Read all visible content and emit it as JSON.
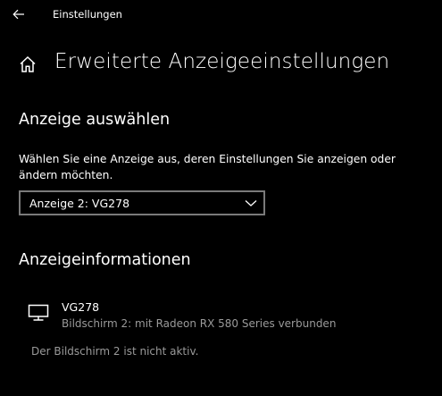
{
  "window": {
    "title": "Einstellungen"
  },
  "page": {
    "title": "Erweiterte Anzeigeeinstellungen"
  },
  "select_display": {
    "heading": "Anzeige auswählen",
    "description": "Wählen Sie eine Anzeige aus, deren Einstellungen Sie anzeigen oder ändern möchten.",
    "dropdown_value": "Anzeige 2: VG278"
  },
  "display_info": {
    "heading": "Anzeigeinformationen",
    "monitor_name": "VG278",
    "monitor_detail": "Bildschirm 2: mit Radeon RX 580 Series verbunden",
    "inactive_note": "Der Bildschirm 2 ist nicht aktiv."
  },
  "icons": {
    "back": "back-arrow-icon",
    "home": "home-icon",
    "dropdown": "chevron-down-icon",
    "monitor": "monitor-icon"
  },
  "colors": {
    "background": "#000000",
    "text": "#ffffff",
    "secondary_text": "#9a9a9a",
    "dropdown_border": "#7a7a7a"
  }
}
